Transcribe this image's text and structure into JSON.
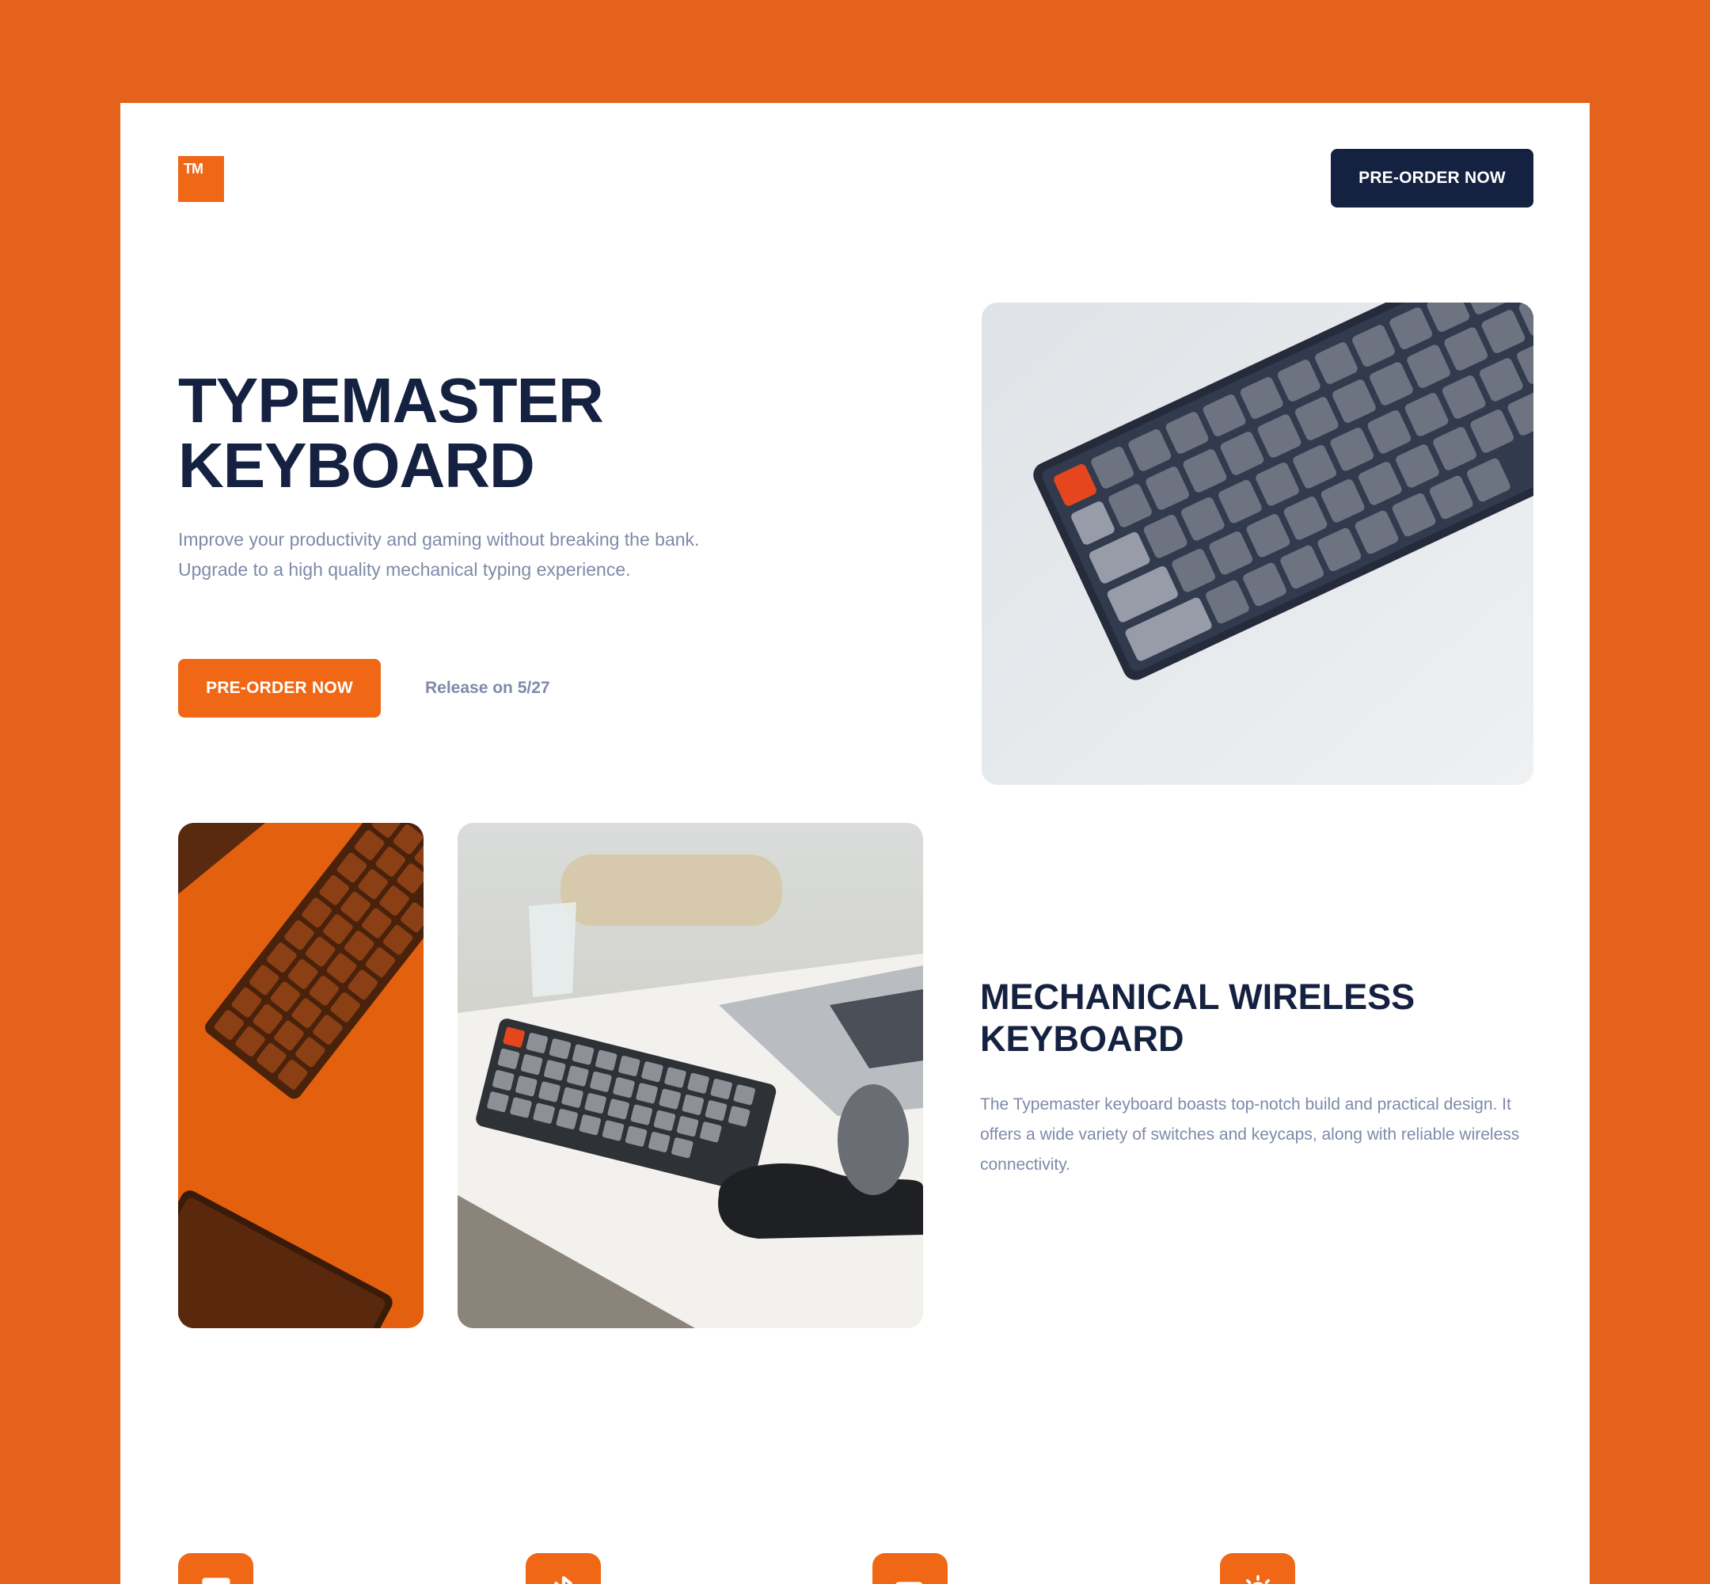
{
  "header": {
    "logo_text": "TM",
    "preorder_label": "PRE-ORDER NOW"
  },
  "hero": {
    "title_line1": "TYPEMASTER",
    "title_line2": "KEYBOARD",
    "description": "Improve your productivity and gaming without breaking the bank. Upgrade to a high quality mechanical typing experience.",
    "cta_label": "PRE-ORDER NOW",
    "release_text": "Release on 5/27"
  },
  "feature_section": {
    "title_line1": "MECHANICAL WIRELESS",
    "title_line2": "KEYBOARD",
    "description": "The Typemaster keyboard boasts top-notch build and practical design. It offers a wide variety of switches and keycaps, along with reliable wireless connectivity."
  },
  "features": [
    {
      "icon": "monitor-icon"
    },
    {
      "icon": "bluetooth-icon"
    },
    {
      "icon": "battery-icon"
    },
    {
      "icon": "lightbulb-icon"
    }
  ],
  "colors": {
    "background": "#e4621b",
    "accent": "#f06816",
    "navy": "#152140",
    "muted_text": "#7e8aa8"
  }
}
